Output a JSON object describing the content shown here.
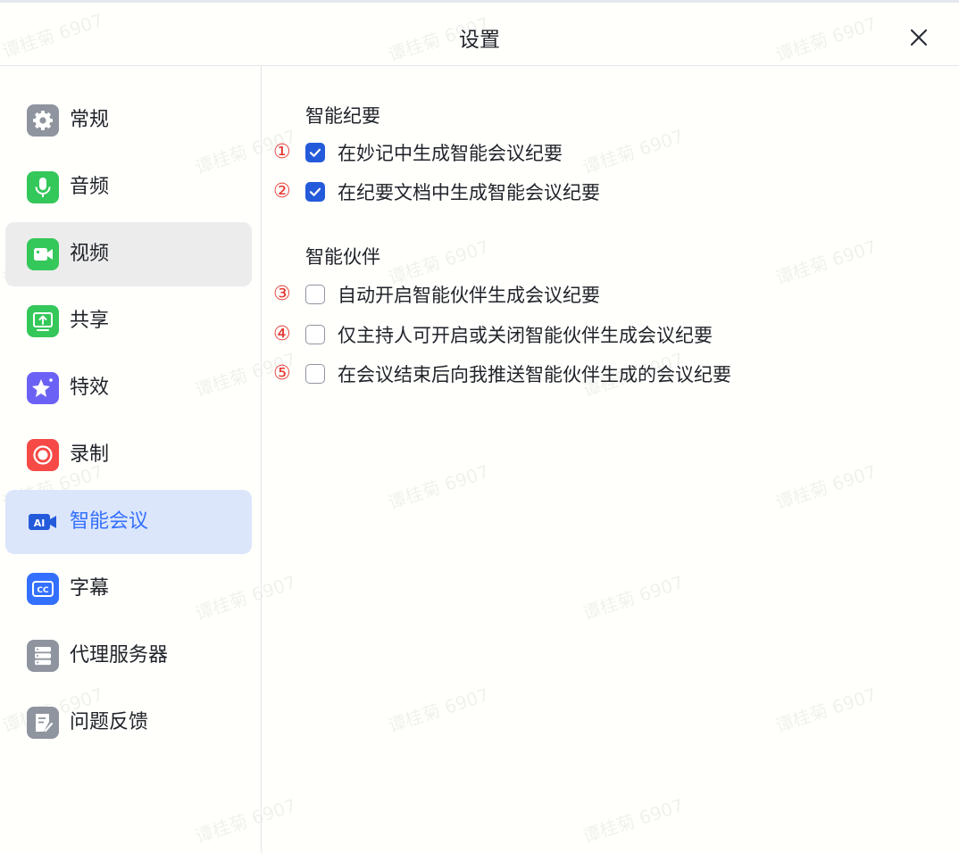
{
  "window": {
    "title": "设置"
  },
  "watermark": {
    "text": "谭桂菊 6907"
  },
  "sidebar": {
    "items": [
      {
        "label": "常规",
        "icon": "gear-icon",
        "color": "#8f959e"
      },
      {
        "label": "音频",
        "icon": "microphone-icon",
        "color": "#34c759"
      },
      {
        "label": "视频",
        "icon": "video-camera-icon",
        "color": "#34c759"
      },
      {
        "label": "共享",
        "icon": "screen-share-icon",
        "color": "#34c759"
      },
      {
        "label": "特效",
        "icon": "effects-icon",
        "color": "#6b62f5"
      },
      {
        "label": "录制",
        "icon": "record-icon",
        "color": "#f54a45"
      },
      {
        "label": "智能会议",
        "icon": "ai-meeting-icon",
        "color": "#3370ff"
      },
      {
        "label": "字幕",
        "icon": "captions-icon",
        "color": "#3370ff"
      },
      {
        "label": "代理服务器",
        "icon": "server-icon",
        "color": "#8f959e"
      },
      {
        "label": "问题反馈",
        "icon": "feedback-icon",
        "color": "#8f959e"
      }
    ],
    "active_item": "智能会议",
    "hovered_item": "视频"
  },
  "content": {
    "sections": [
      {
        "title": "智能纪要",
        "options": [
          {
            "marker": "①",
            "label": "在妙记中生成智能会议纪要",
            "checked": true
          },
          {
            "marker": "②",
            "label": "在纪要文档中生成智能会议纪要",
            "checked": true
          }
        ]
      },
      {
        "title": "智能伙伴",
        "options": [
          {
            "marker": "③",
            "label": "自动开启智能伙伴生成会议纪要",
            "checked": false
          },
          {
            "marker": "④",
            "label": "仅主持人可开启或关闭智能伙伴生成会议纪要",
            "checked": false
          },
          {
            "marker": "⑤",
            "label": "在会议结束后向我推送智能伙伴生成的会议纪要",
            "checked": false
          }
        ]
      }
    ]
  },
  "colors": {
    "accent": "#3370ff",
    "checkbox_checked": "#245bdb",
    "marker": "#e53935",
    "active_bg": "#dce6fb",
    "hover_bg": "#ececec"
  }
}
